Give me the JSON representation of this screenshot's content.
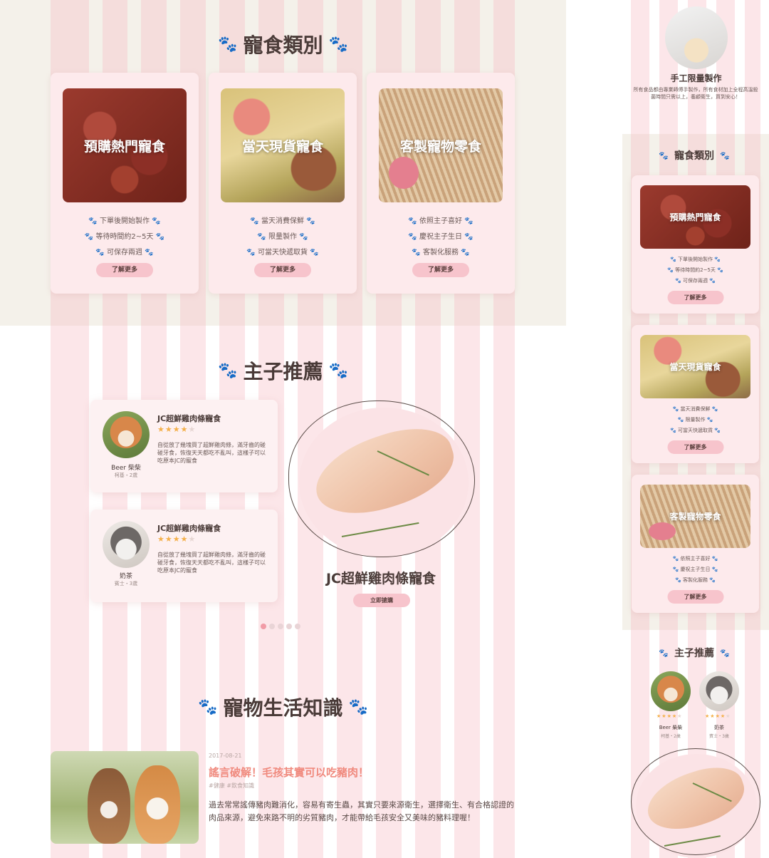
{
  "colors": {
    "accent_pink": "#f7c4cc",
    "title_orange": "#f08a7e",
    "star": "#f4b04a",
    "beige_background": "#f4f1ea",
    "card_pink": "#fdeaec"
  },
  "desktop": {
    "categories": {
      "title": "寵食類別",
      "cards": [
        {
          "image_label": "預購熱門寵食",
          "features": [
            "下單後開始製作",
            "等待時間約2~5天",
            "可保存兩週"
          ],
          "button": "了解更多"
        },
        {
          "image_label": "當天現貨寵食",
          "features": [
            "當天消費保鮮",
            "限量製作",
            "可當天快遞取貨"
          ],
          "button": "了解更多"
        },
        {
          "image_label": "客製寵物零食",
          "features": [
            "依照主子喜好",
            "慶祝主子生日",
            "客製化服務"
          ],
          "button": "了解更多"
        }
      ]
    },
    "recommend": {
      "title": "主子推薦",
      "reviews": [
        {
          "product": "JC超鮮雞肉條寵食",
          "stars": "★★★★★",
          "rating": 4,
          "text": "自從放了幾塊買了超鮮雞肉條，滿牙齒的碰碰牙食，恢復天天都吃不亂叫，這樣子可以吃原本JC的寵食",
          "name": "Beer 柴柴",
          "sub": "柯基・2歲"
        },
        {
          "product": "JC超鮮雞肉條寵食",
          "stars": "★★★★★",
          "rating": 4,
          "text": "自從放了幾塊買了超鮮雞肉條，滿牙齒的碰碰牙食，恢復天天都吃不亂叫，這樣子可以吃原本JC的寵食",
          "name": "奶茶",
          "sub": "賓士・3歲"
        }
      ],
      "featured_product": "JC超鮮雞肉條寵食",
      "buy_button": "立即搶購",
      "dots_total": 5,
      "dot_active": 1
    },
    "knowledge": {
      "title": "寵物生活知識",
      "article": {
        "date": "2017-08-21",
        "title": "謠言破解！毛孩其實可以吃豬肉！",
        "tags": "#健康 #飲食知識",
        "body": "過去常常謠傳豬肉難消化，容易有寄生蟲，其實只要來源衛生，選擇衛生、有合格認證的肉品來源，避免來路不明的劣質豬肉，才能帶給毛孩安全又美味的豬料理喔！"
      }
    }
  },
  "mobile": {
    "handmade": {
      "title": "手工限量製作",
      "text": "所有食品都由專業師傅手製作，所有食材加上全程高溫殺菌時間只需以上，養顧衛生，買到安心！"
    },
    "categories": {
      "title": "寵食類別",
      "cards": [
        {
          "image_label": "預購熱門寵食",
          "features": [
            "下單後開始製作",
            "等待時間約2~5天",
            "可保存兩週"
          ],
          "button": "了解更多"
        },
        {
          "image_label": "當天現貨寵食",
          "features": [
            "當天消費保鮮",
            "限量製作",
            "可當天快遞取貨"
          ],
          "button": "了解更多"
        },
        {
          "image_label": "客製寵物零食",
          "features": [
            "依照主子喜好",
            "慶祝主子生日",
            "客製化服務"
          ],
          "button": "了解更多"
        }
      ]
    },
    "recommend": {
      "title": "主子推薦",
      "reviewers": [
        {
          "stars": "★★★★★",
          "rating": 4,
          "name": "Beer 柴柴",
          "sub": "柯基・2歲"
        },
        {
          "stars": "★★★★★",
          "rating": 4,
          "name": "奶茶",
          "sub": "賓士・3歲"
        }
      ]
    }
  }
}
